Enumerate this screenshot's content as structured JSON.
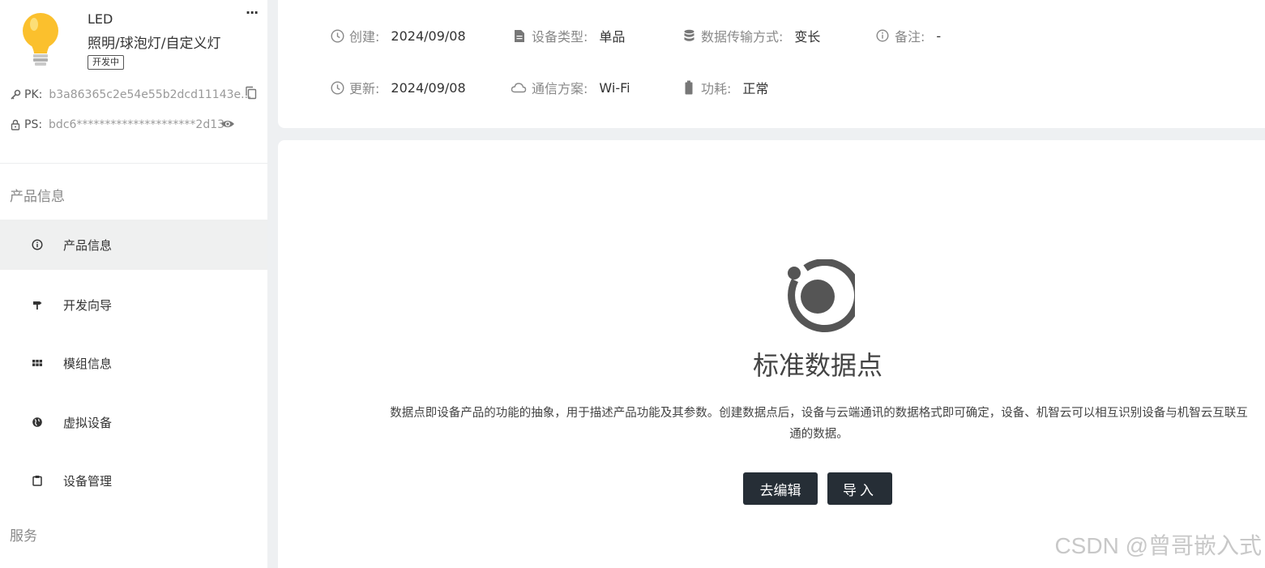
{
  "product": {
    "name": "LED",
    "category": "照明/球泡灯/自定义灯",
    "status": "开发中",
    "more": "···",
    "pk_label": "PK:",
    "pk_value": "b3a86365c2e54e55b2dcd11143e...",
    "ps_label": "PS:",
    "ps_value": "bdc6*********************2d13"
  },
  "sidebar": {
    "section_product": "产品信息",
    "section_service": "服务",
    "items": [
      {
        "label": "产品信息",
        "icon": "info-circle-icon",
        "active": true
      },
      {
        "label": "开发向导",
        "icon": "signpost-icon",
        "active": false
      },
      {
        "label": "模组信息",
        "icon": "grid-icon",
        "active": false
      },
      {
        "label": "虚拟设备",
        "icon": "globe-icon",
        "active": false
      },
      {
        "label": "设备管理",
        "icon": "clipboard-icon",
        "active": false
      }
    ]
  },
  "info": {
    "created_label": "创建:",
    "created_value": "2024/09/08",
    "device_type_label": "设备类型:",
    "device_type_value": "单品",
    "transfer_label": "数据传输方式:",
    "transfer_value": "变长",
    "remark_label": "备注:",
    "remark_value": "-",
    "updated_label": "更新:",
    "updated_value": "2024/09/08",
    "comm_label": "通信方案:",
    "comm_value": "Wi-Fi",
    "power_label": "功耗:",
    "power_value": "正常"
  },
  "datapoint": {
    "title": "标准数据点",
    "description": "数据点即设备产品的功能的抽象，用于描述产品功能及其参数。创建数据点后，设备与云端通讯的数据格式即可确定，设备、机智云可以相互识别设备与机智云互联互通的数据。",
    "edit_button": "去编辑",
    "import_button": "导入"
  },
  "watermark": "CSDN @曾哥嵌入式",
  "colors": {
    "accent_dark": "#262e36",
    "active_bg": "#eff0f0",
    "bulb_yellow": "#fbc02d"
  }
}
